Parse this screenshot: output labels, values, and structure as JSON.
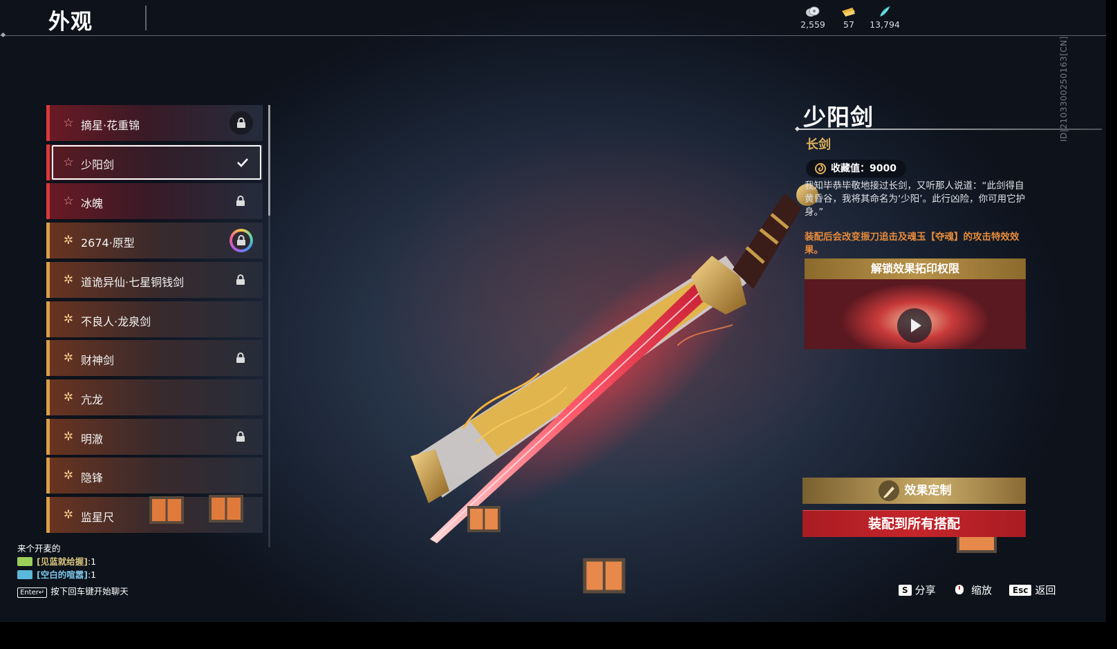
{
  "header": {
    "title": "外观",
    "currencies": [
      {
        "icon": "coin-stack-icon",
        "value": "2,559"
      },
      {
        "icon": "gold-ticket-icon",
        "value": "57"
      },
      {
        "icon": "jade-feather-icon",
        "value": "13,794"
      }
    ]
  },
  "list": {
    "items": [
      {
        "label": "摘星·花重锦",
        "tier": "red",
        "lock": "circle-lock"
      },
      {
        "label": "少阳剑",
        "tier": "red",
        "lock": "check",
        "selected": true
      },
      {
        "label": "冰魄",
        "tier": "red",
        "lock": "lock"
      },
      {
        "label": "2674·原型",
        "tier": "gold",
        "lock": "rainbow-lock"
      },
      {
        "label": "道诡异仙·七星铜钱剑",
        "tier": "gold",
        "lock": "lock"
      },
      {
        "label": "不良人·龙泉剑",
        "tier": "gold",
        "lock": "none"
      },
      {
        "label": "财神剑",
        "tier": "gold",
        "lock": "lock"
      },
      {
        "label": "亢龙",
        "tier": "gold",
        "lock": "none"
      },
      {
        "label": "明澈",
        "tier": "gold",
        "lock": "lock"
      },
      {
        "label": "隐锋",
        "tier": "gold",
        "lock": "none"
      },
      {
        "label": "监星尺",
        "tier": "gold",
        "lock": "none"
      }
    ]
  },
  "detail": {
    "name": "少阳剑",
    "type": "长剑",
    "collection_label": "收藏值：9000",
    "description": "我知毕恭毕敬地接过长剑，又听那人说道：“此剑得自黄昏谷，我将其命名为‘少阳’。此行凶险，你可用它护身。”",
    "effect_note": "装配后会改变振刀追击及魂玉【夺魂】的攻击特效效果。",
    "unlock_title": "解锁效果拓印权限",
    "customize_label": "效果定制",
    "equip_label": "装配到所有搭配",
    "vertical_id": "ID|2103300250163[CN]"
  },
  "chat": {
    "lines": [
      {
        "text": "来个开麦的"
      },
      {
        "name": "[见蓝就给握]",
        "suffix": ":1",
        "badge_color": "#9ccf5a"
      },
      {
        "name": "[空白的喧嚣]",
        "suffix": ":1",
        "badge_color": "#5ab8d9"
      }
    ],
    "enter_key": "Enter↵",
    "hint": "按下回车键开始聊天"
  },
  "hints": {
    "share_key": "S",
    "share_label": "分享",
    "zoom_label": "缩放",
    "esc_key": "Esc",
    "back_label": "返回"
  },
  "colors": {
    "accent_gold": "#e0b15a",
    "equip_red": "#c5252b",
    "effect_orange": "#e58a3c"
  }
}
